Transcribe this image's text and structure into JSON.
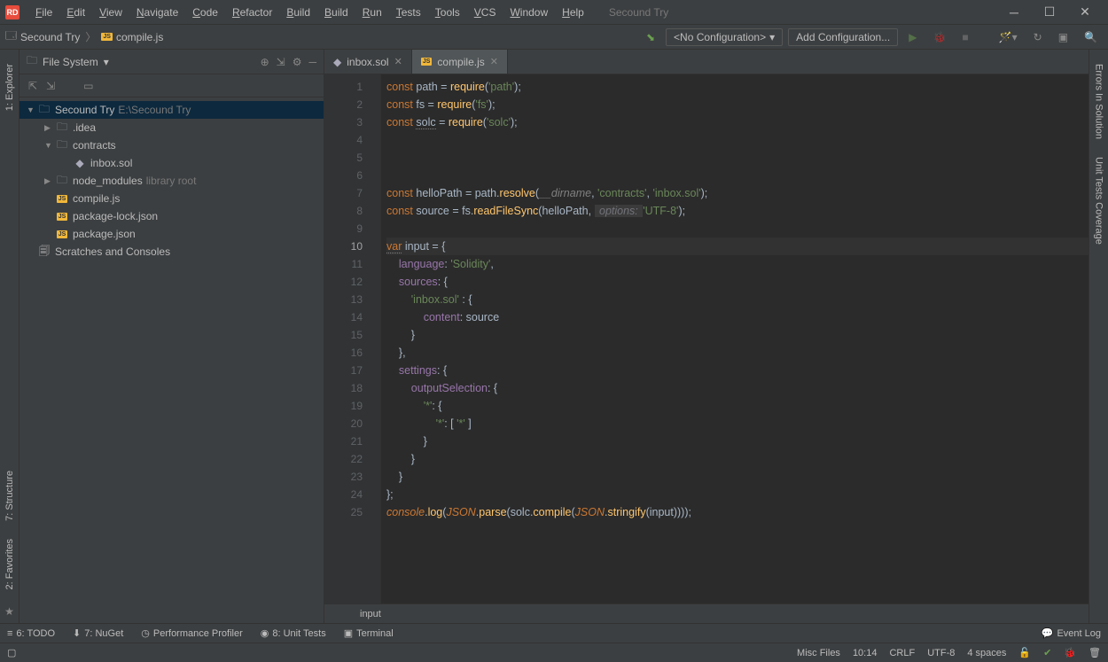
{
  "window": {
    "app_icon": "RD",
    "project_name": "Secound Try"
  },
  "menu": [
    "File",
    "Edit",
    "View",
    "Navigate",
    "Code",
    "Refactor",
    "Build",
    "Build",
    "Run",
    "Tests",
    "Tools",
    "VCS",
    "Window",
    "Help"
  ],
  "toolbar": {
    "breadcrumb": [
      "Secound Try",
      "compile.js"
    ],
    "config": "<No Configuration>",
    "add_config": "Add Configuration..."
  },
  "sidebar": {
    "title": "File System",
    "gutter_tabs": [
      "1: Explorer",
      "7: Structure",
      "2: Favorites"
    ],
    "right_gutter_tabs": [
      "Errors In Solution",
      "Unit Tests Coverage"
    ],
    "tree": {
      "root": {
        "label": "Secound Try",
        "hint": "E:\\Secound Try"
      },
      "items": [
        {
          "label": ".idea",
          "type": "folder",
          "expanded": false,
          "indent": 1,
          "arrow": true
        },
        {
          "label": "contracts",
          "type": "folder",
          "expanded": true,
          "indent": 1,
          "arrow": true
        },
        {
          "label": "inbox.sol",
          "type": "eth",
          "indent": 2
        },
        {
          "label": "node_modules",
          "type": "folder",
          "hint": "library root",
          "indent": 1,
          "arrow": true
        },
        {
          "label": "compile.js",
          "type": "js",
          "indent": 1
        },
        {
          "label": "package-lock.json",
          "type": "js",
          "indent": 1
        },
        {
          "label": "package.json",
          "type": "js",
          "indent": 1
        }
      ],
      "scratches": "Scratches and Consoles"
    }
  },
  "editor": {
    "tabs": [
      {
        "label": "inbox.sol",
        "icon": "eth",
        "active": false
      },
      {
        "label": "compile.js",
        "icon": "js",
        "active": true
      }
    ],
    "current_line": 10,
    "breadcrumb_context": "input",
    "code": [
      {
        "n": 1,
        "seg": [
          [
            "kw",
            "const"
          ],
          [
            "",
            " path "
          ],
          [
            "",
            "= "
          ],
          [
            "fn",
            "require"
          ],
          [
            "",
            "("
          ],
          [
            "str",
            "'path'"
          ],
          [
            "",
            ");"
          ]
        ]
      },
      {
        "n": 2,
        "seg": [
          [
            "kw",
            "const"
          ],
          [
            "",
            " fs "
          ],
          [
            "",
            "= "
          ],
          [
            "fn",
            "require"
          ],
          [
            "",
            "("
          ],
          [
            "str",
            "'fs'"
          ],
          [
            "",
            ");"
          ]
        ]
      },
      {
        "n": 3,
        "seg": [
          [
            "kw",
            "const"
          ],
          [
            "",
            " "
          ],
          [
            "warn-ul",
            "solc"
          ],
          [
            "",
            " = "
          ],
          [
            "fn",
            "require"
          ],
          [
            "",
            "("
          ],
          [
            "str",
            "'solc'"
          ],
          [
            "",
            ");"
          ]
        ]
      },
      {
        "n": 4,
        "seg": []
      },
      {
        "n": 5,
        "seg": []
      },
      {
        "n": 6,
        "seg": []
      },
      {
        "n": 7,
        "seg": [
          [
            "kw",
            "const"
          ],
          [
            "",
            " helloPath "
          ],
          [
            "",
            "= path."
          ],
          [
            "fn",
            "resolve"
          ],
          [
            "",
            "("
          ],
          [
            "param",
            "__dirname"
          ],
          [
            "",
            ", "
          ],
          [
            "str",
            "'contracts'"
          ],
          [
            "",
            ", "
          ],
          [
            "str",
            "'inbox.sol'"
          ],
          [
            "",
            ");"
          ]
        ]
      },
      {
        "n": 8,
        "seg": [
          [
            "kw",
            "const"
          ],
          [
            "",
            " source "
          ],
          [
            "",
            "= fs."
          ],
          [
            "fn",
            "readFileSync"
          ],
          [
            "",
            "(helloPath, "
          ],
          [
            "arg",
            " options: "
          ],
          [
            "str",
            "'UTF-8'"
          ],
          [
            "",
            ");"
          ]
        ]
      },
      {
        "n": 9,
        "seg": []
      },
      {
        "n": 10,
        "seg": [
          [
            "kw warn-ul",
            "var"
          ],
          [
            "",
            " input = "
          ],
          [
            "",
            "{"
          ]
        ],
        "current": true
      },
      {
        "n": 11,
        "seg": [
          [
            "",
            "    "
          ],
          [
            "prop",
            "language"
          ],
          [
            "",
            ": "
          ],
          [
            "str",
            "'Solidity'"
          ],
          [
            "",
            ","
          ]
        ]
      },
      {
        "n": 12,
        "seg": [
          [
            "",
            "    "
          ],
          [
            "prop",
            "sources"
          ],
          [
            "",
            ": {"
          ]
        ]
      },
      {
        "n": 13,
        "seg": [
          [
            "",
            "        "
          ],
          [
            "str",
            "'inbox.sol'"
          ],
          [
            "",
            " : {"
          ]
        ]
      },
      {
        "n": 14,
        "seg": [
          [
            "",
            "            "
          ],
          [
            "prop",
            "content"
          ],
          [
            "",
            ": source"
          ]
        ]
      },
      {
        "n": 15,
        "seg": [
          [
            "",
            "        }"
          ]
        ]
      },
      {
        "n": 16,
        "seg": [
          [
            "",
            "    },"
          ]
        ]
      },
      {
        "n": 17,
        "seg": [
          [
            "",
            "    "
          ],
          [
            "prop",
            "settings"
          ],
          [
            "",
            ": {"
          ]
        ]
      },
      {
        "n": 18,
        "seg": [
          [
            "",
            "        "
          ],
          [
            "prop",
            "outputSelection"
          ],
          [
            "",
            ": {"
          ]
        ]
      },
      {
        "n": 19,
        "seg": [
          [
            "",
            "            "
          ],
          [
            "str",
            "'*'"
          ],
          [
            "",
            ": {"
          ]
        ]
      },
      {
        "n": 20,
        "seg": [
          [
            "",
            "                "
          ],
          [
            "str",
            "'*'"
          ],
          [
            "",
            ": [ "
          ],
          [
            "str",
            "'*'"
          ],
          [
            "",
            " ]"
          ]
        ]
      },
      {
        "n": 21,
        "seg": [
          [
            "",
            "            }"
          ]
        ]
      },
      {
        "n": 22,
        "seg": [
          [
            "",
            "        }"
          ]
        ]
      },
      {
        "n": 23,
        "seg": [
          [
            "",
            "    }"
          ]
        ]
      },
      {
        "n": 24,
        "seg": [
          [
            "",
            "};"
          ]
        ]
      },
      {
        "n": 25,
        "seg": [
          [
            "global",
            "console"
          ],
          [
            "",
            "."
          ],
          [
            "fn",
            "log"
          ],
          [
            "",
            "("
          ],
          [
            "global",
            "JSON"
          ],
          [
            "",
            "."
          ],
          [
            "fn",
            "parse"
          ],
          [
            "",
            "(solc."
          ],
          [
            "fn",
            "compile"
          ],
          [
            "",
            "("
          ],
          [
            "global",
            "JSON"
          ],
          [
            "",
            "."
          ],
          [
            "fn",
            "stringify"
          ],
          [
            "",
            "(input))));"
          ]
        ]
      }
    ]
  },
  "bottom_tabs": [
    "6: TODO",
    "7: NuGet",
    "Performance Profiler",
    "8: Unit Tests",
    "Terminal"
  ],
  "event_log": "Event Log",
  "status": {
    "misc": "Misc Files",
    "pos": "10:14",
    "eol": "CRLF",
    "enc": "UTF-8",
    "indent": "4 spaces"
  }
}
